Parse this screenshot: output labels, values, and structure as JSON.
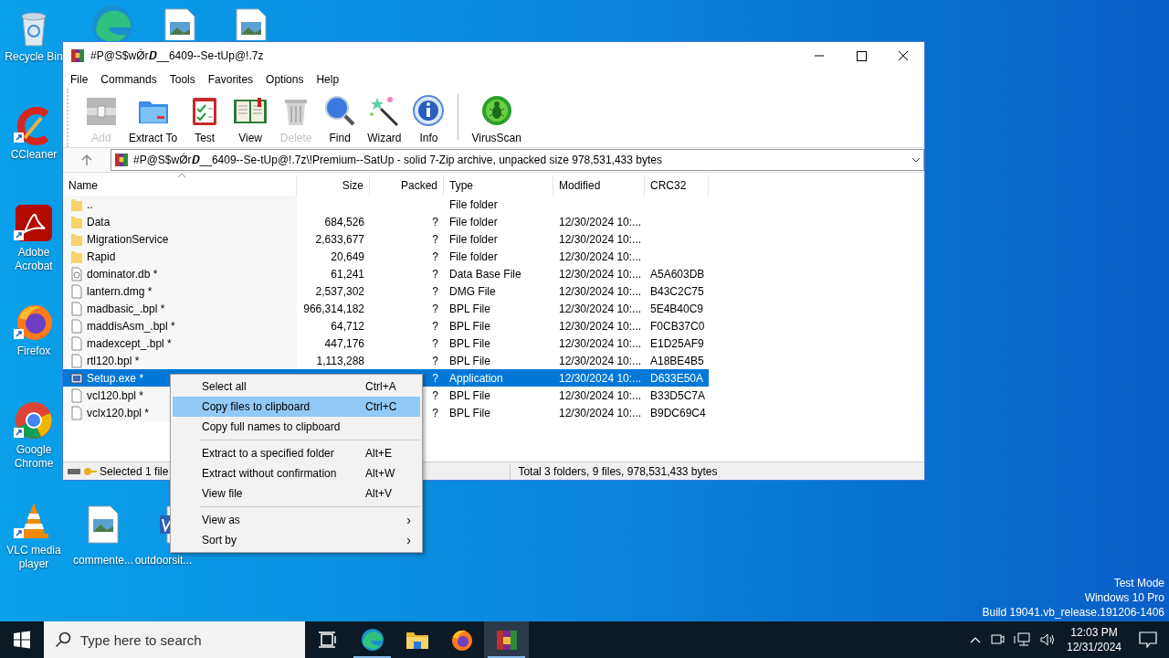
{
  "desktop_icons": [
    {
      "kind": "recycle",
      "label": "Recycle Bin"
    },
    {
      "kind": "ccleaner",
      "label": "CCleaner",
      "shortcut": true
    },
    {
      "kind": "acrobat",
      "label": "Adobe Acrobat",
      "shortcut": true
    },
    {
      "kind": "firefox",
      "label": "Firefox",
      "shortcut": true
    },
    {
      "kind": "chrome",
      "label": "Google Chrome",
      "shortcut": true
    },
    {
      "kind": "vlc",
      "label": "VLC media player",
      "shortcut": true
    },
    {
      "kind": "image",
      "label": "commente..."
    },
    {
      "kind": "word",
      "label": "outdoorsit..."
    },
    {
      "kind": "edge"
    },
    {
      "kind": "image"
    },
    {
      "kind": "image"
    }
  ],
  "window": {
    "title": "#P@S$wǾr𝑫__6409--Se-tUp@!.7z",
    "menu": [
      "File",
      "Commands",
      "Tools",
      "Favorites",
      "Options",
      "Help"
    ],
    "toolbar": [
      {
        "kind": "add",
        "label": "Add",
        "disabled": true
      },
      {
        "kind": "extract",
        "label": "Extract To",
        "disabled": false
      },
      {
        "kind": "test",
        "label": "Test",
        "disabled": false
      },
      {
        "kind": "view",
        "label": "View",
        "disabled": false
      },
      {
        "kind": "delete",
        "label": "Delete",
        "disabled": true
      },
      {
        "kind": "find",
        "label": "Find",
        "disabled": false
      },
      {
        "kind": "wizard",
        "label": "Wizard",
        "disabled": false
      },
      {
        "kind": "info",
        "label": "Info",
        "disabled": false
      },
      {
        "kind": "separator"
      },
      {
        "kind": "virus",
        "label": "VirusScan",
        "disabled": false
      }
    ],
    "address": "#P@S$wǾr𝑫__6409--Se-tUp@!.7z\\!Premium--SatUp - solid 7-Zip archive, unpacked size 978,531,433 bytes",
    "columns": [
      "Name",
      "Size",
      "Packed",
      "Type",
      "Modified",
      "CRC32"
    ],
    "rows": [
      {
        "kind": "folder",
        "name": "..",
        "type": "File folder",
        "selected": false
      },
      {
        "kind": "folder",
        "name": "Data",
        "size": "684,526",
        "packed": "?",
        "type": "File folder",
        "modified": "12/30/2024 10:...",
        "selected": false
      },
      {
        "kind": "folder",
        "name": "MigrationService",
        "size": "2,633,677",
        "packed": "?",
        "type": "File folder",
        "modified": "12/30/2024 10:...",
        "selected": false
      },
      {
        "kind": "folder",
        "name": "Rapid",
        "size": "20,649",
        "packed": "?",
        "type": "File folder",
        "modified": "12/30/2024 10:...",
        "selected": false
      },
      {
        "kind": "db",
        "name": "dominator.db *",
        "size": "61,241",
        "packed": "?",
        "type": "Data Base File",
        "modified": "12/30/2024 10:...",
        "crc": "A5A603DB",
        "selected": false
      },
      {
        "kind": "file",
        "name": "lantern.dmg *",
        "size": "2,537,302",
        "packed": "?",
        "type": "DMG File",
        "modified": "12/30/2024 10:...",
        "crc": "B43C2C75",
        "selected": false
      },
      {
        "kind": "file",
        "name": "madbasic_.bpl *",
        "size": "966,314,182",
        "packed": "?",
        "type": "BPL File",
        "modified": "12/30/2024 10:...",
        "crc": "5E4B40C9",
        "selected": false
      },
      {
        "kind": "file",
        "name": "maddisAsm_.bpl *",
        "size": "64,712",
        "packed": "?",
        "type": "BPL File",
        "modified": "12/30/2024 10:...",
        "crc": "F0CB37C0",
        "selected": false
      },
      {
        "kind": "file",
        "name": "madexcept_.bpl *",
        "size": "447,176",
        "packed": "?",
        "type": "BPL File",
        "modified": "12/30/2024 10:...",
        "crc": "E1D25AF9",
        "selected": false
      },
      {
        "kind": "file",
        "name": "rtl120.bpl *",
        "size": "1,113,288",
        "packed": "?",
        "type": "BPL File",
        "modified": "12/30/2024 10:...",
        "crc": "A18BE4B5",
        "selected": false
      },
      {
        "kind": "exe",
        "name": "Setup.exe *",
        "packed": "?",
        "type": "Application",
        "modified": "12/30/2024 10:...",
        "crc": "D633E50A",
        "selected": true
      },
      {
        "kind": "file",
        "name": "vcl120.bpl *",
        "packed": "?",
        "type": "BPL File",
        "modified": "12/30/2024 10:...",
        "crc": "B33D5C7A",
        "selected": false
      },
      {
        "kind": "file",
        "name": "vclx120.bpl *",
        "packed": "?",
        "type": "BPL File",
        "modified": "12/30/2024 10:...",
        "crc": "B9DC69C4",
        "selected": false
      }
    ],
    "status_left": "Selected 1 file",
    "status_right": "Total 3 folders, 9 files, 978,531,433 bytes"
  },
  "context_menu": [
    {
      "kind": "item",
      "label": "Select all",
      "shortcut": "Ctrl+A",
      "selected": false
    },
    {
      "kind": "item",
      "label": "Copy files to clipboard",
      "shortcut": "Ctrl+C",
      "selected": true
    },
    {
      "kind": "item",
      "label": "Copy full names to clipboard",
      "selected": false
    },
    {
      "kind": "separator"
    },
    {
      "kind": "item",
      "label": "Extract to a specified folder",
      "shortcut": "Alt+E",
      "selected": false
    },
    {
      "kind": "item",
      "label": "Extract without confirmation",
      "shortcut": "Alt+W",
      "selected": false
    },
    {
      "kind": "item",
      "label": "View file",
      "shortcut": "Alt+V",
      "selected": false
    },
    {
      "kind": "separator"
    },
    {
      "kind": "submenu",
      "label": "View as",
      "arrow": "›",
      "selected": false
    },
    {
      "kind": "submenu",
      "label": "Sort by",
      "arrow": "›",
      "selected": false
    }
  ],
  "desktop_notice": [
    "Test Mode",
    "Windows 10 Pro",
    "Build 19041.vb_release.191206-1406"
  ],
  "taskbar": {
    "search_placeholder": "Type here to search",
    "apps": [
      {
        "kind": "taskview",
        "running": false,
        "active": false
      },
      {
        "kind": "edge",
        "running": true,
        "active": false
      },
      {
        "kind": "explorer",
        "running": false,
        "active": false
      },
      {
        "kind": "firefox",
        "running": false,
        "active": false
      },
      {
        "kind": "winrar",
        "running": true,
        "active": true
      }
    ],
    "time": "12:03 PM",
    "date": "12/31/2024"
  }
}
